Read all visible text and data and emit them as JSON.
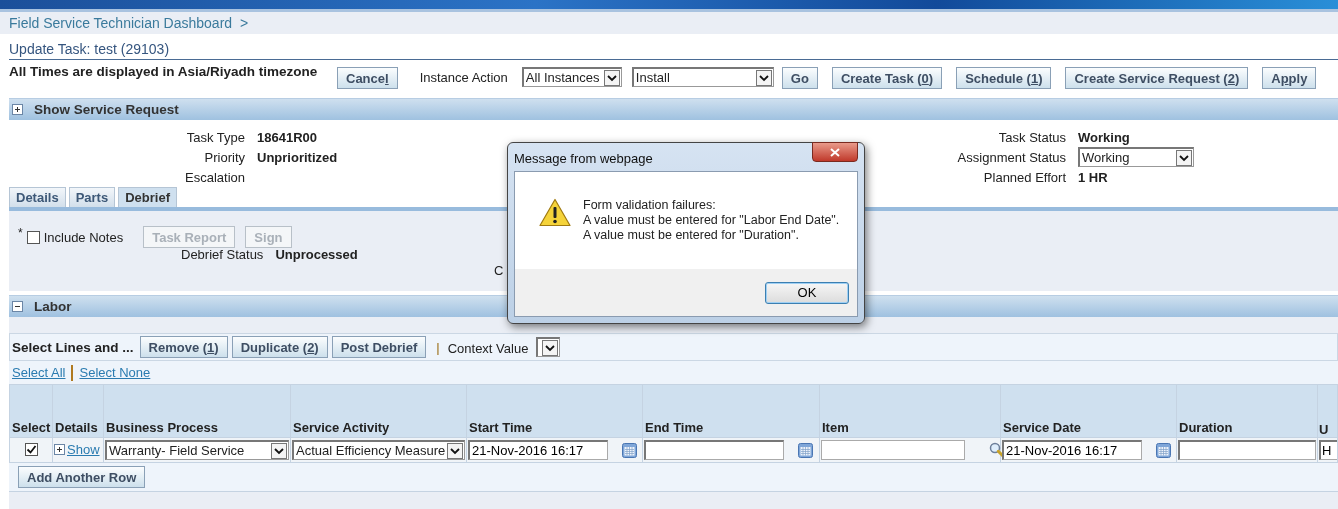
{
  "breadcrumb": {
    "label": "Field Service Technician Dashboard",
    "separator": ">"
  },
  "page_title": "Update Task: test (29103)",
  "timezone_note": "All Times are displayed in Asia/Riyadh timezone",
  "toolbar": [
    {
      "kind": "button",
      "before": "Cance",
      "key": "l"
    },
    {
      "kind": "label",
      "text": "Instance Action"
    },
    {
      "kind": "select",
      "value": "All Instances"
    },
    {
      "kind": "select",
      "value": "Install"
    },
    {
      "kind": "button",
      "before": "Go"
    },
    {
      "kind": "button",
      "before": "Create Task (",
      "key": "0",
      "after": ")"
    },
    {
      "kind": "button",
      "before": "Schedule (",
      "key": "1",
      "after": ")"
    },
    {
      "kind": "button",
      "before": "Create Service Request (",
      "key": "2",
      "after": ")"
    },
    {
      "kind": "button",
      "before": "A",
      "key": "p",
      "after": "ply"
    }
  ],
  "service_request_section": {
    "title": "Show Service Request",
    "expanded": false
  },
  "info_left": [
    {
      "label": "Task Type",
      "value": "18641R00"
    },
    {
      "label": "Priority",
      "value": "Unprioritized"
    },
    {
      "label": "Escalation"
    }
  ],
  "info_right": [
    {
      "label": "Task Status",
      "kind": "text",
      "value": "Working"
    },
    {
      "label": "Assignment Status",
      "kind": "select",
      "value": "Working"
    },
    {
      "label": "Planned Effort",
      "kind": "text",
      "value": "1 HR"
    }
  ],
  "tabs": [
    {
      "label": "Details",
      "selected": false
    },
    {
      "label": "Parts",
      "selected": false
    },
    {
      "label": "Debrief",
      "selected": true
    }
  ],
  "debrief": {
    "required_mark": "*",
    "include_notes": {
      "label": "Include Notes",
      "checked": false
    },
    "buttons": [
      {
        "label": "Task Report",
        "disabled": true
      },
      {
        "label": "Sign",
        "disabled": true
      }
    ],
    "status_label": "Debrief Status",
    "status_value": "Unprocessed",
    "partial_label": "C"
  },
  "labor_section": {
    "title": "Labor",
    "expanded": true
  },
  "labor_toolbar": {
    "title": "Select Lines and ...",
    "buttons": [
      {
        "before": "Remove (",
        "key": "1",
        "after": ")"
      },
      {
        "before": "Duplicate (",
        "key": "2",
        "after": ")"
      },
      {
        "before": "Post Debrief"
      }
    ],
    "separator": "|",
    "context_label": "Context Value"
  },
  "select_links": [
    {
      "label": "Select All"
    },
    {
      "label": "Select None"
    }
  ],
  "table": {
    "columns": [
      "Select",
      "Details",
      "Business Process",
      "Service Activity",
      "Start Time",
      "End Time",
      "Item",
      "Service Date",
      "Duration",
      "U"
    ],
    "rows": [
      [
        {
          "kind": "checkbox",
          "checked": true
        },
        {
          "kind": "expand_link",
          "text": "Show"
        },
        {
          "kind": "select",
          "value": "Warranty- Field Service"
        },
        {
          "kind": "select",
          "value": "Actual Efficiency Measure"
        },
        {
          "kind": "date",
          "value": "21-Nov-2016 16:17"
        },
        {
          "kind": "date"
        },
        {
          "kind": "lookup"
        },
        {
          "kind": "date",
          "value": "21-Nov-2016 16:17"
        },
        {
          "kind": "text"
        },
        {
          "kind": "text",
          "value": "H"
        }
      ]
    ]
  },
  "add_row_button": "Add Another Row",
  "dialog": {
    "title": "Message from webpage",
    "lines": [
      "Form validation failures:",
      "A value must be entered for \"Labor End Date\".",
      "A value must be entered for \"Duration\"."
    ],
    "button": "OK"
  }
}
